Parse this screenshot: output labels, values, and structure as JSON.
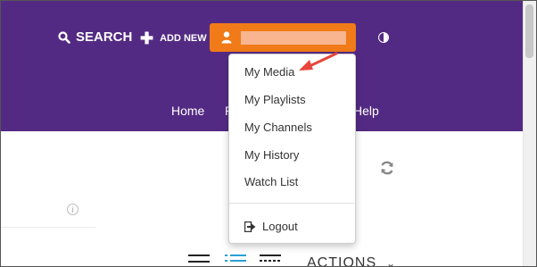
{
  "header": {
    "search_label": "SEARCH",
    "add_new_label": "ADD NEW",
    "user_name": "",
    "brand_color": "#532a83",
    "user_button_color": "#f07b18"
  },
  "nav": {
    "home": "Home",
    "partial": "P",
    "help": "Help"
  },
  "dropdown": {
    "items": [
      {
        "label": "My Media"
      },
      {
        "label": "My Playlists"
      },
      {
        "label": "My Channels"
      },
      {
        "label": "My History"
      },
      {
        "label": "Watch List"
      }
    ],
    "logout": "Logout"
  },
  "content": {
    "actions_label": "ACTIONS",
    "info_symbol": "i"
  },
  "annotation": {
    "arrow_color": "#e8453c",
    "points_to": "My Media"
  }
}
